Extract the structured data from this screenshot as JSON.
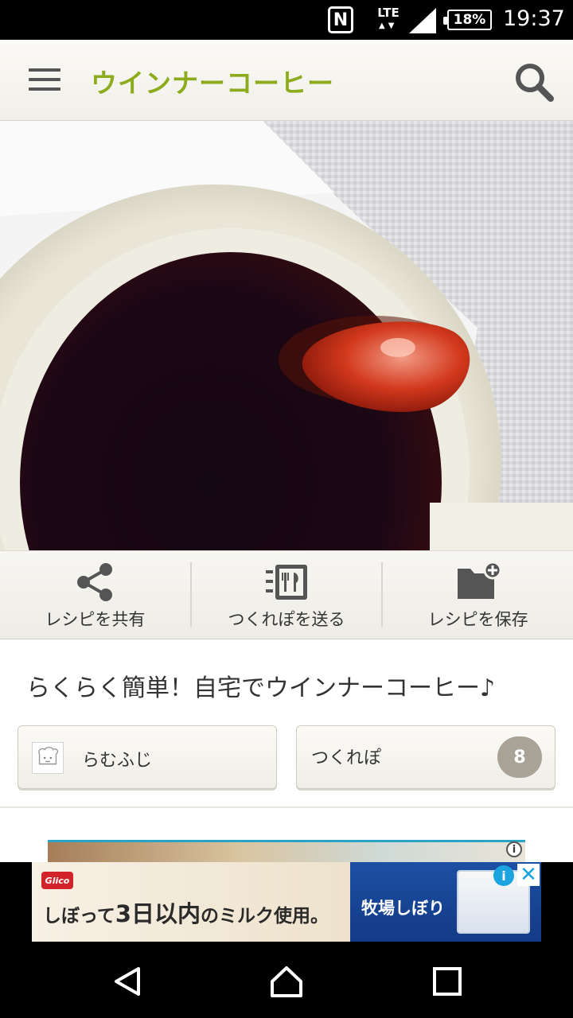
{
  "status_bar": {
    "nfc": "N",
    "network": "LTE",
    "battery": "18%",
    "time": "19:37"
  },
  "app_bar": {
    "title": "ウインナーコーヒー",
    "accent_color": "#8cac1d"
  },
  "photo": {
    "icon": "recipe-photo"
  },
  "actions": [
    {
      "label": "レシピを共有",
      "icon": "share-icon"
    },
    {
      "label": "つくれぽを送る",
      "icon": "tsukurepo-send-icon"
    },
    {
      "label": "レシピを保存",
      "icon": "folder-add-icon"
    }
  ],
  "recipe": {
    "title": "らくらく簡単！自宅でウインナーコーヒー♪",
    "author": "らむふじ",
    "tsukurepo_label": "つくれぽ",
    "tsukurepo_count": "8"
  },
  "ad": {
    "brand": "Glico",
    "copy_prefix": "しぼって",
    "copy_highlight": "3日以内",
    "copy_suffix": "のミルク使用。",
    "product": "牧場しぼり",
    "info_label": "i",
    "close_label": "✕"
  }
}
